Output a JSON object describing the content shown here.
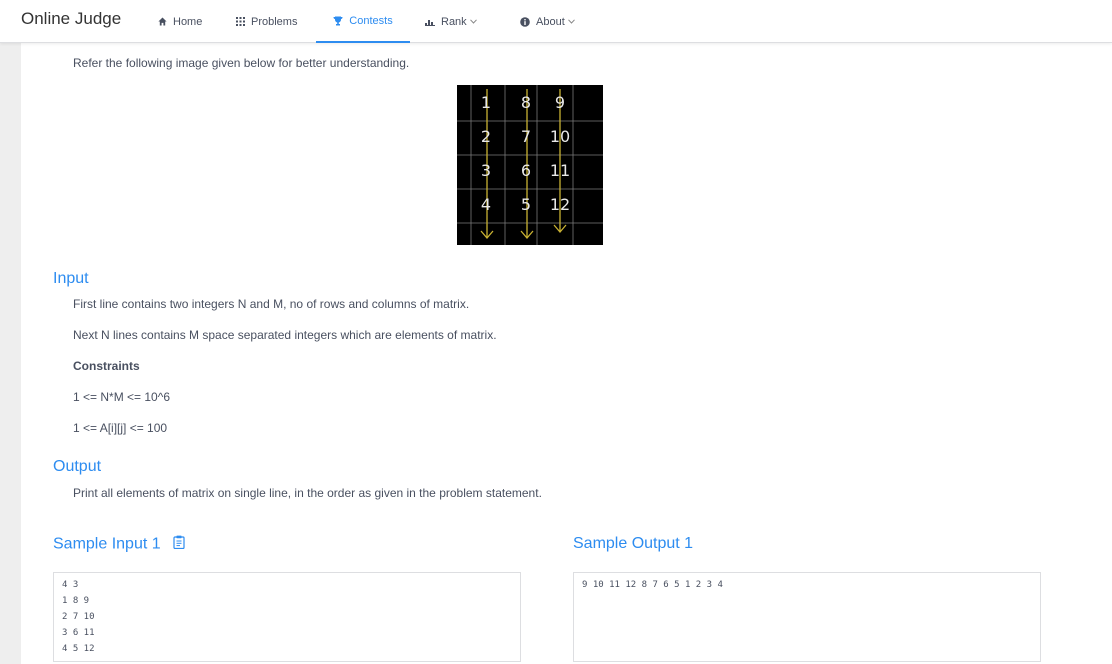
{
  "nav": {
    "brand": "Online Judge",
    "items": [
      {
        "label": "Home",
        "icon": "home-icon"
      },
      {
        "label": "Problems",
        "icon": "grid-icon"
      },
      {
        "label": "Contests",
        "icon": "trophy-icon",
        "active": true
      },
      {
        "label": "Rank",
        "icon": "bar-chart-icon"
      },
      {
        "label": "About",
        "icon": "info-icon"
      }
    ]
  },
  "problem": {
    "refer_text": "Refer the following image given below for better understanding.",
    "figure": {
      "grid": [
        [
          "1",
          "8",
          "9"
        ],
        [
          "2",
          "7",
          "10"
        ],
        [
          "3",
          "6",
          "11"
        ],
        [
          "4",
          "5",
          "12"
        ]
      ]
    },
    "input": {
      "title": "Input",
      "lines": [
        "First line contains two integers N and M, no of rows and columns of matrix.",
        "Next N lines contains M space separated integers which are elements of matrix."
      ],
      "constraints_title": "Constraints",
      "constraints": [
        "1 <= N*M <= 10^6",
        "1 <= A[i][j] <= 100"
      ]
    },
    "output": {
      "title": "Output",
      "text": "Print all elements of matrix on single line, in the order as given in the problem statement."
    },
    "sample_input": {
      "title": "Sample Input 1",
      "lines": [
        "4 3",
        "1 8 9",
        "2 7 10",
        "3 6 11",
        "4 5 12"
      ]
    },
    "sample_output": {
      "title": "Sample Output 1",
      "lines": [
        "9 10 11 12 8 7 6 5 1 2 3 4"
      ]
    }
  },
  "colors": {
    "accent": "#2d8cf0",
    "text": "#495060",
    "background": "#eeeeee"
  }
}
